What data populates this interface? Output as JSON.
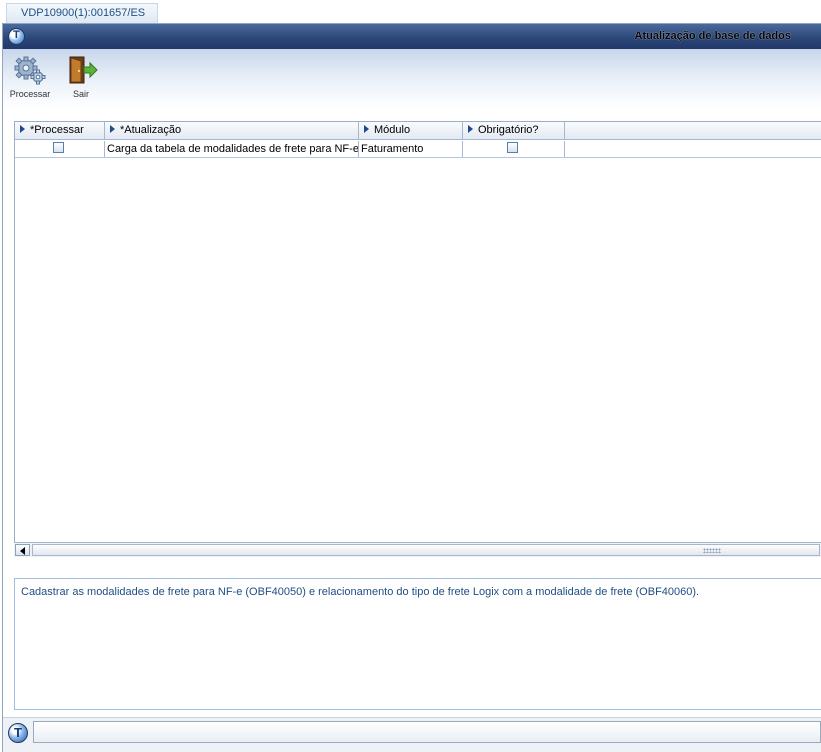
{
  "tab": {
    "label": "VDP10900(1):001657/ES"
  },
  "window": {
    "title": "Atualização de base de dados"
  },
  "toolbar": {
    "buttons": [
      {
        "label": "Processar",
        "icon": "gears-icon"
      },
      {
        "label": "Sair",
        "icon": "exit-door-icon"
      }
    ]
  },
  "grid": {
    "columns": [
      "*Processar",
      "*Atualização",
      "Módulo",
      "Obrigatório?"
    ],
    "rows": [
      {
        "processar": false,
        "atualizacao": "Carga da tabela de modalidades de frete para NF-e",
        "modulo": "Faturamento",
        "obrigatorio": false
      }
    ]
  },
  "description": "Cadastrar as modalidades de frete para NF-e (OBF40050) e relacionamento do tipo de frete Logix com a modalidade de frete (OBF40060).",
  "colors": {
    "title_bar": "#2c4879",
    "accent_text": "#1f4e86"
  }
}
